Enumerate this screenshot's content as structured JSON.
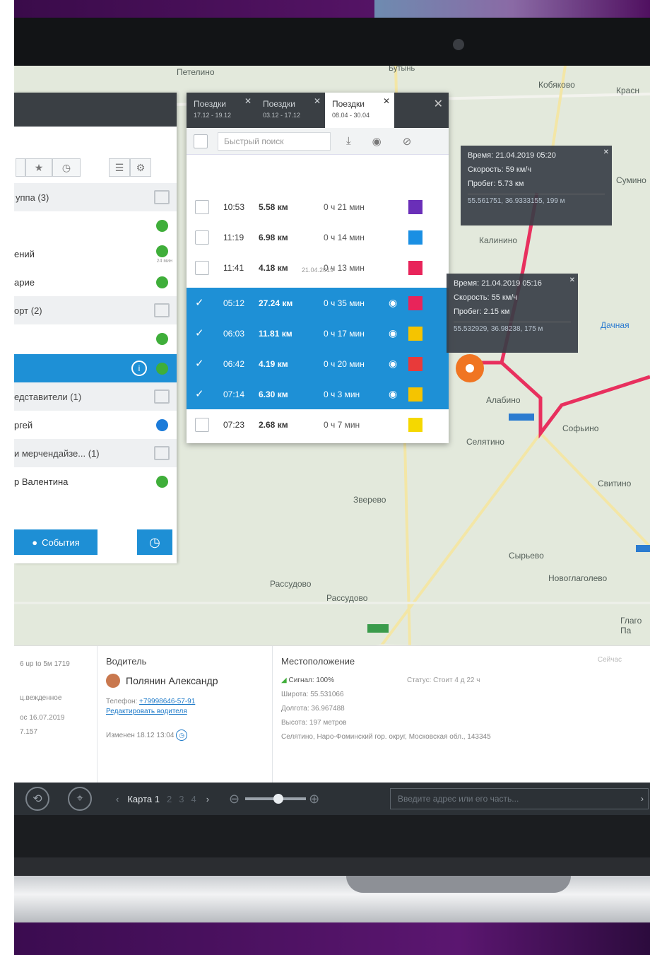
{
  "map": {
    "labels": [
      "Петелино",
      "Бутынь",
      "Кобяково",
      "Красн",
      "Сумино",
      "Калинино",
      "Дачная",
      "Алабино",
      "Селятино",
      "Софьино",
      "Зверево",
      "Свитино",
      "Сырьево",
      "Рассудово",
      "Рассудово",
      "Новоглаголево",
      "Глаго Па"
    ],
    "route_color": "#e8305e"
  },
  "left_panel": {
    "groups": [
      {
        "label": "уппа (3)"
      },
      {
        "label": "орт (2)"
      },
      {
        "label": "едставители (1)"
      },
      {
        "label": "и мерчендайзе... (1)"
      }
    ],
    "items": [
      {
        "label": ""
      },
      {
        "label": "ений"
      },
      {
        "label": "арие"
      },
      {
        "label": ""
      },
      {
        "label": "ргей"
      },
      {
        "label": "р Валентина"
      }
    ],
    "time_badge": "24 мин",
    "events_button": "События"
  },
  "trips": {
    "tabs": [
      {
        "label": "Поездки",
        "range": "17.12 - 19.12"
      },
      {
        "label": "Поездки",
        "range": "03.12 - 17.12"
      },
      {
        "label": "Поездки",
        "range": "08.04 - 30.04"
      }
    ],
    "search_placeholder": "Быстрый поиск",
    "date_separator": "21.04.2019",
    "rows": [
      {
        "time": "10:53",
        "dist": "5.58 км",
        "dur": "0 ч 21 мин",
        "color": "#6a2fb8",
        "selected": false
      },
      {
        "time": "11:19",
        "dist": "6.98 км",
        "dur": "0 ч 14 мин",
        "color": "#1a8fe3",
        "selected": false
      },
      {
        "time": "11:41",
        "dist": "4.18 км",
        "dur": "0 ч 13 мин",
        "color": "#e8245a",
        "selected": false
      },
      {
        "time": "05:12",
        "dist": "27.24 км",
        "dur": "0 ч 35 мин",
        "color": "#e8245a",
        "selected": true
      },
      {
        "time": "06:03",
        "dist": "11.81 км",
        "dur": "0 ч 17 мин",
        "color": "#f5c400",
        "selected": true
      },
      {
        "time": "06:42",
        "dist": "4.19 км",
        "dur": "0 ч 20 мин",
        "color": "#e83a3a",
        "selected": true
      },
      {
        "time": "07:14",
        "dist": "6.30 км",
        "dur": "0 ч 3 мин",
        "color": "#f5c400",
        "selected": true
      },
      {
        "time": "07:23",
        "dist": "2.68 км",
        "dur": "0 ч 7 мин",
        "color": "#f5d800",
        "selected": false
      }
    ]
  },
  "tooltips": [
    {
      "time": "Время: 21.04.2019 05:20",
      "speed": "Скорость: 59 км/ч",
      "mileage": "Пробег: 5.73 км",
      "coords": "55.561751, 36.9333155, 199 м"
    },
    {
      "time": "Время: 21.04.2019 05:16",
      "speed": "Скорость: 55 км/ч",
      "mileage": "Пробег: 2.15 км",
      "coords": "55.532929, 36.98238, 175 м"
    }
  ],
  "info": {
    "left_col": [
      "6 up to 5м 1719",
      "ц.вежденное",
      "ос 16.07.2019",
      "7.157"
    ],
    "driver": {
      "heading": "Водитель",
      "name": "Полянин Александр",
      "phone_label": "Телефон:",
      "phone": "+79998646-57-91",
      "edit_link": "Редактировать водителя",
      "changed": "Изменен 18.12 13:04"
    },
    "location": {
      "heading": "Местоположение",
      "signal": "Сигнал: 100%",
      "status": "Статус: Стоит 4 д 22 ч",
      "latitude": "Широта: 55.531066",
      "longitude": "Долгота: 36.967488",
      "altitude": "Высота: 197 метров",
      "address": "Селятино, Наро-Фоминский гор. округ, Московская обл., 143345",
      "tab_hint": "Сейчас"
    }
  },
  "toolbar": {
    "prev": "‹",
    "map_label": "Карта 1",
    "pages": [
      "2",
      "3",
      "4"
    ],
    "next": "›",
    "address_placeholder": "Введите адрес или его часть...",
    "go": "›"
  }
}
